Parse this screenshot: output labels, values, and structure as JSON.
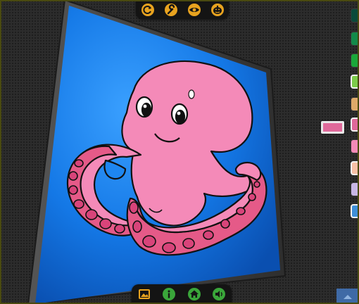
{
  "toolbar_top": {
    "buttons": [
      {
        "icon": "refresh-icon"
      },
      {
        "icon": "wrench-icon"
      },
      {
        "icon": "eye-icon"
      },
      {
        "icon": "pumpkin-icon"
      }
    ]
  },
  "toolbar_bottom": {
    "buttons": [
      {
        "icon": "gallery-icon"
      },
      {
        "icon": "info-icon"
      },
      {
        "icon": "home-icon"
      },
      {
        "icon": "sound-icon"
      }
    ]
  },
  "colors": {
    "icon_orange": "#e8a31f",
    "icon_green": "#3aa63a",
    "background_blue": "#1878e8",
    "octopus_pink": "#f48ab8",
    "sucker_pink": "#e55a88",
    "selected": "#e0699a"
  },
  "palette": [
    {
      "color": "#0a4a3a",
      "outlined": false
    },
    {
      "color": "#138a4a",
      "outlined": false
    },
    {
      "color": "#1aa83a",
      "outlined": false
    },
    {
      "color": "#7ccc4a",
      "outlined": true
    },
    {
      "color": "#deaa6a",
      "outlined": false
    },
    {
      "color": "#e0699a",
      "outlined": true
    },
    {
      "color": "#f48ab8",
      "outlined": false
    },
    {
      "color": "#f7c0a6",
      "outlined": true
    },
    {
      "color": "#c8b7e6",
      "outlined": false
    },
    {
      "color": "#3f8fd8",
      "outlined": true
    }
  ]
}
